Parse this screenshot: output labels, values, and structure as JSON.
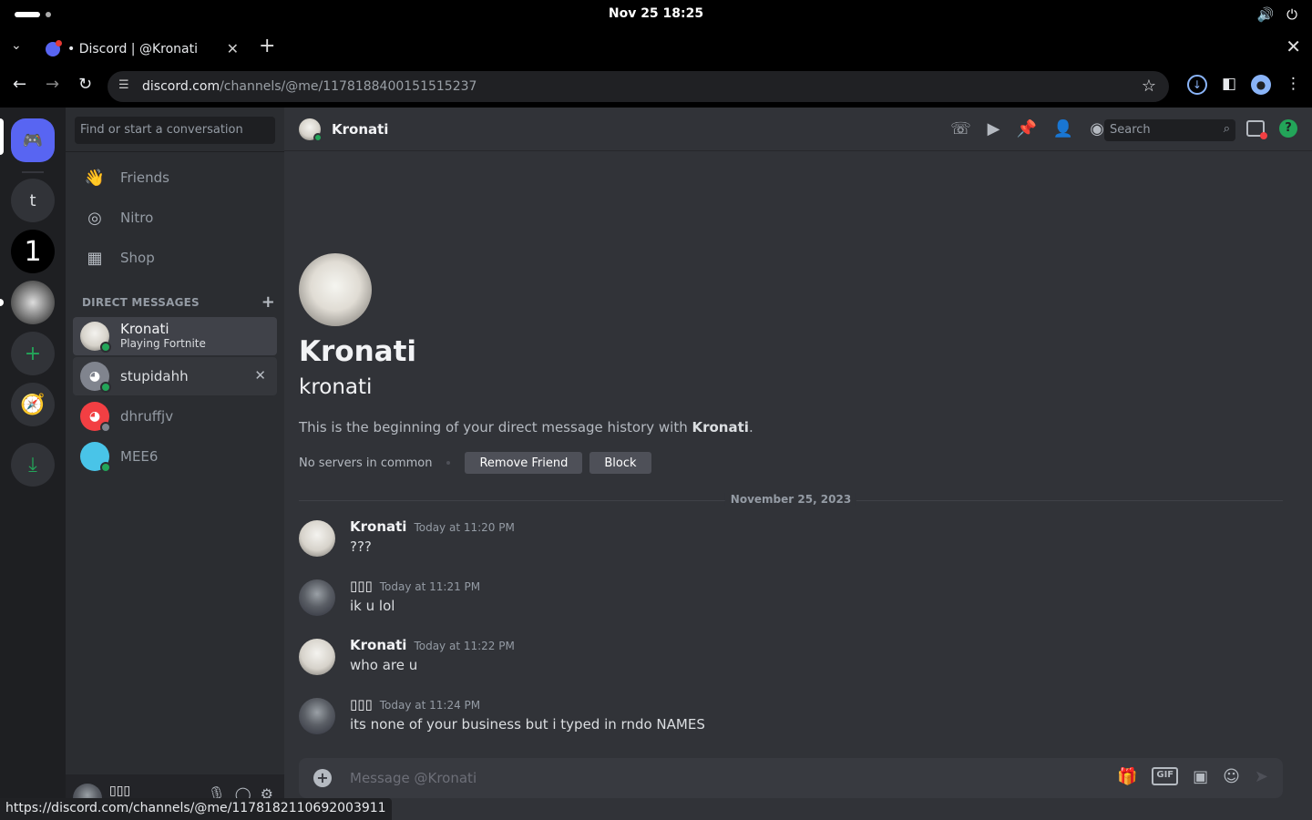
{
  "os": {
    "clock": "Nov 25  18:25",
    "volume_icon": "speaker-icon",
    "power_icon": "power-icon"
  },
  "browser": {
    "tab_title": "• Discord | @Kronati",
    "url_host": "discord.com",
    "url_path": "/channels/@me/1178188400151515237",
    "status_url": "https://discord.com/channels/@me/1178182110692003911"
  },
  "guilds": {
    "items": [
      "t",
      "1"
    ]
  },
  "sidebar": {
    "search_placeholder": "Find or start a conversation",
    "nav": [
      {
        "label": "Friends",
        "icon": "friends-icon"
      },
      {
        "label": "Nitro",
        "icon": "nitro-icon"
      },
      {
        "label": "Shop",
        "icon": "shop-icon"
      }
    ],
    "dm_header": "DIRECT MESSAGES",
    "dms": [
      {
        "name": "Kronati",
        "sub": "Playing Fortnite"
      },
      {
        "name": "stupidahh"
      },
      {
        "name": "dhruffjv"
      },
      {
        "name": "MEE6"
      }
    ],
    "user": {
      "name": "▯▯▯"
    }
  },
  "chat": {
    "title": "Kronati",
    "search_placeholder": "Search",
    "intro": {
      "display_name": "Kronati",
      "username": "kronati",
      "text_prefix": "This is the beginning of your direct message history with ",
      "text_name": "Kronati",
      "text_suffix": ".",
      "servers": "No servers in common",
      "remove_label": "Remove Friend",
      "block_label": "Block"
    },
    "date_divider": "November 25, 2023",
    "messages": [
      {
        "author": "Kronati",
        "time": "Today at 11:20 PM",
        "text": "???"
      },
      {
        "author": "▯▯▯",
        "time": "Today at 11:21 PM",
        "text": "ik u lol"
      },
      {
        "author": "Kronati",
        "time": "Today at 11:22 PM",
        "text": "who are u"
      },
      {
        "author": "▯▯▯",
        "time": "Today at 11:24 PM",
        "text": "its none of your business but i typed in rndo NAMES"
      }
    ],
    "composer_placeholder": "Message @Kronati"
  }
}
